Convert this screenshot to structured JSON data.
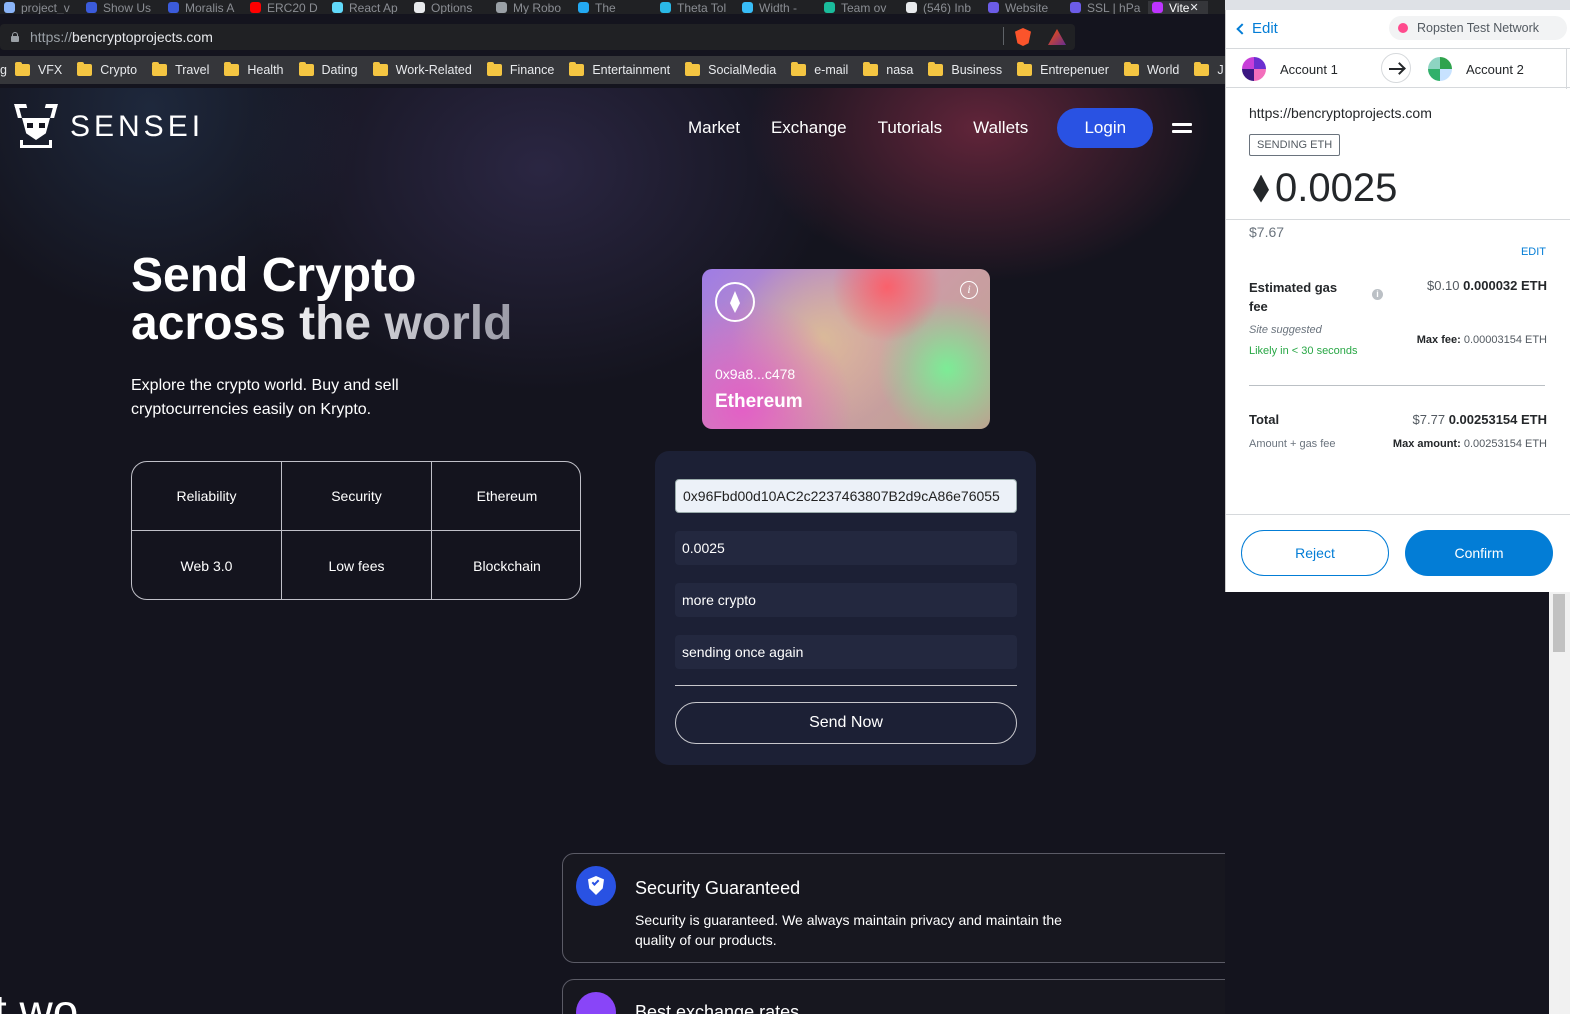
{
  "browser": {
    "tabs": [
      {
        "title": "project_v",
        "color": "#8ab4f8"
      },
      {
        "title": "Show Us",
        "color": "#3b5bdb"
      },
      {
        "title": "Moralis A",
        "color": "#3b5bdb"
      },
      {
        "title": "ERC20 D",
        "color": "#ff0000"
      },
      {
        "title": "React Ap",
        "color": "#61dafb"
      },
      {
        "title": "Options",
        "color": "#e8eaed"
      },
      {
        "title": "My Robo",
        "color": "#9aa0a6"
      },
      {
        "title": "The",
        "color": "#23a9f2"
      },
      {
        "title": "Theta Tol",
        "color": "#2ab8e6"
      },
      {
        "title": "Width -",
        "color": "#38bdf8"
      },
      {
        "title": "Team ov",
        "color": "#1abc9c"
      },
      {
        "title": "(546) Inb",
        "color": "#e8eaed"
      },
      {
        "title": "Website",
        "color": "#6c5ce7"
      },
      {
        "title": "SSL | hPa",
        "color": "#6c5ce7"
      },
      {
        "title": "Vite",
        "color": "#bd34fe",
        "active": true
      }
    ],
    "url_scheme": "https://",
    "url_host": "bencryptoprojects.com",
    "bookmarks": [
      "g",
      "VFX",
      "Crypto",
      "Travel",
      "Health",
      "Dating",
      "Work-Related",
      "Finance",
      "Entertainment",
      "SocialMedia",
      "e-mail",
      "nasa",
      "Business",
      "Entrepenuer",
      "World",
      "J"
    ]
  },
  "site": {
    "logo_text": "SENSEI",
    "nav": {
      "market": "Market",
      "exchange": "Exchange",
      "tutorials": "Tutorials",
      "wallets": "Wallets",
      "login": "Login"
    },
    "hero": {
      "title_line1": "Send Crypto",
      "title_line2": "across the world",
      "subtitle": "Explore the crypto world. Buy and sell cryptocurrencies easily on Krypto."
    },
    "features": [
      "Reliability",
      "Security",
      "Ethereum",
      "Web 3.0",
      "Low fees",
      "Blockchain"
    ],
    "card": {
      "address": "0x9a8...c478",
      "network": "Ethereum"
    },
    "form": {
      "address": "0x96Fbd00d10AC2c2237463807B2d9cA86e76055",
      "amount": "0.0025",
      "keyword": "more crypto",
      "message": "sending once again",
      "send_label": "Send Now"
    },
    "services": [
      {
        "title": "Security Guaranteed",
        "description": "Security is guaranteed. We always maintain privacy and maintain the quality of our products.",
        "color": "#2952e3"
      },
      {
        "title": "Best exchange rates",
        "description": "",
        "color": "#8945f8"
      }
    ],
    "partial_heading": "t wo"
  },
  "metamask": {
    "back_label": "Edit",
    "network": "Ropsten Test Network",
    "from_account": "Account 1",
    "to_account": "Account 2",
    "origin": "https://bencryptoprojects.com",
    "badge": "SENDING ETH",
    "amount": "0.0025",
    "fiat": "$7.67",
    "edit": "EDIT",
    "gas": {
      "label": "Estimated gas fee",
      "fiat": "$0.10",
      "eth": "0.000032 ETH",
      "site_suggested": "Site suggested",
      "likely": "Likely in < 30 seconds",
      "max_fee_label": "Max fee:",
      "max_fee_value": "0.00003154 ETH"
    },
    "total": {
      "label": "Total",
      "fiat": "$7.77",
      "eth": "0.00253154 ETH",
      "sub_label": "Amount + gas fee",
      "max_amount_label": "Max amount:",
      "max_amount_value": "0.00253154 ETH"
    },
    "reject": "Reject",
    "confirm": "Confirm"
  }
}
